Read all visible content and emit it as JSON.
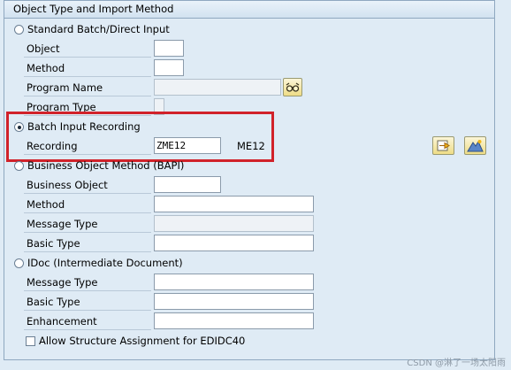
{
  "group": {
    "title": "Object Type and Import Method"
  },
  "standard": {
    "radio_label": "Standard Batch/Direct Input",
    "selected": false,
    "fields": {
      "object": {
        "label": "Object",
        "value": ""
      },
      "method": {
        "label": "Method",
        "value": ""
      },
      "program_name": {
        "label": "Program Name",
        "value": ""
      },
      "program_type": {
        "label": "Program Type",
        "value": ""
      }
    }
  },
  "batch": {
    "radio_label": "Batch Input Recording",
    "selected": true,
    "recording": {
      "label": "Recording",
      "value": "ZME12",
      "description": "ME12"
    }
  },
  "bapi": {
    "radio_label": "Business Object Method  (BAPI)",
    "selected": false,
    "fields": {
      "business_object": {
        "label": "Business Object",
        "value": ""
      },
      "method": {
        "label": "Method",
        "value": ""
      },
      "message_type": {
        "label": "Message Type",
        "value": ""
      },
      "basic_type": {
        "label": "Basic Type",
        "value": ""
      }
    }
  },
  "idoc": {
    "radio_label": "IDoc (Intermediate Document)",
    "selected": false,
    "fields": {
      "message_type": {
        "label": "Message Type",
        "value": ""
      },
      "basic_type": {
        "label": "Basic Type",
        "value": ""
      },
      "enhancement": {
        "label": "Enhancement",
        "value": ""
      }
    },
    "allow_structure_label": "Allow Structure Assignment for EDIDC40",
    "allow_structure_checked": false
  },
  "watermark": "CSDN @淋了一场太阳雨",
  "colors": {
    "highlight_border": "#d1222a",
    "background": "#dfebf5"
  },
  "icons": {
    "program_name_search": "glasses-icon",
    "recording_action": "arrow-right-icon",
    "recording_overview": "mountain-icon"
  }
}
